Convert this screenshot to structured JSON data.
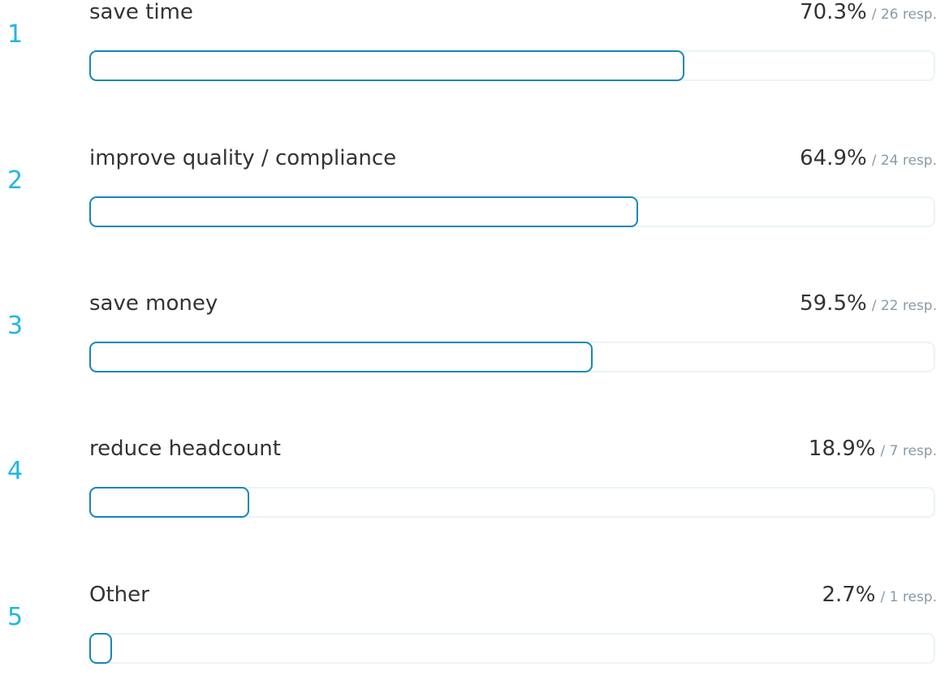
{
  "chart_data": {
    "type": "bar",
    "orientation": "horizontal",
    "categories": [
      "save time",
      "improve quality / compliance",
      "save money",
      "reduce headcount",
      "Other"
    ],
    "values": [
      70.3,
      64.9,
      59.5,
      18.9,
      2.7
    ],
    "responses": [
      26,
      24,
      22,
      7,
      1
    ],
    "unit": "%",
    "xlim": [
      0,
      100
    ]
  },
  "rows": [
    {
      "rank": "1",
      "label": "save time",
      "percent": "70.3%",
      "responses": "/ 26 resp.",
      "fraction": 0.703
    },
    {
      "rank": "2",
      "label": "improve quality / compliance",
      "percent": "64.9%",
      "responses": "/ 24 resp.",
      "fraction": 0.649
    },
    {
      "rank": "3",
      "label": "save money",
      "percent": "59.5%",
      "responses": "/ 22 resp.",
      "fraction": 0.595
    },
    {
      "rank": "4",
      "label": "reduce headcount",
      "percent": "18.9%",
      "responses": "/ 7 resp.",
      "fraction": 0.189
    },
    {
      "rank": "5",
      "label": "Other",
      "percent": "2.7%",
      "responses": "/ 1 resp.",
      "fraction": 0.027
    }
  ],
  "colors": {
    "rank": "#1fb6ea",
    "bar_outline": "#1687b8",
    "track_outline": "#eaf4f9",
    "label": "#333333",
    "responses": "#8a9aa6"
  }
}
